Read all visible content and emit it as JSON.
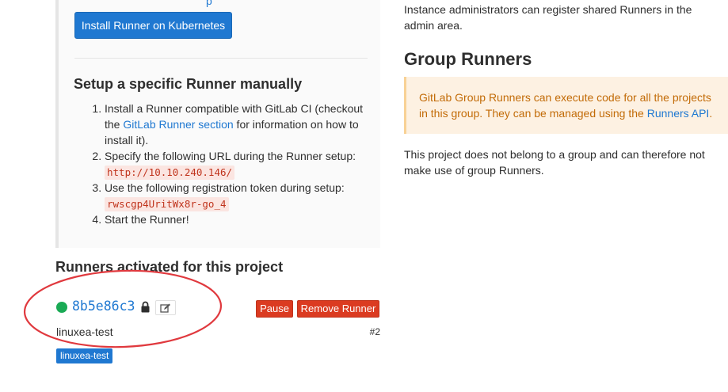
{
  "setup": {
    "top_partial_text": "p",
    "install_k8s_label": "Install Runner on Kubernetes",
    "title": "Setup a specific Runner manually",
    "step1_prefix": "Install a Runner compatible with GitLab CI (checkout the ",
    "step1_link": "GitLab Runner section",
    "step1_suffix": " for information on how to install it).",
    "step2_text": "Specify the following URL during the Runner setup:",
    "step2_url": "http://10.10.240.146/",
    "step3_text": "Use the following registration token during setup:",
    "step3_token": "rwscgp4UritWx8r-go_4",
    "step4_text": "Start the Runner!"
  },
  "activated": {
    "title": "Runners activated for this project",
    "runner": {
      "id": "8b5e86c3",
      "status_color": "#1aaa55",
      "description": "linuxea-test",
      "number": "#2",
      "tag": "linuxea-test",
      "pause_label": "Pause",
      "remove_label": "Remove Runner",
      "lock_icon": "lock-icon",
      "edit_icon": "pencil-square-icon"
    }
  },
  "shared": {
    "text": "Instance administrators can register shared Runners in the admin area."
  },
  "group": {
    "title": "Group Runners",
    "warning_prefix": "GitLab Group Runners can execute code for all the projects in this group. They can be managed using the ",
    "warning_link": "Runners API",
    "warning_suffix": ".",
    "note": "This project does not belong to a group and can therefore not make use of group Runners."
  },
  "colors": {
    "primary_blue": "#1f78d1",
    "danger_red": "#db3b21",
    "warning_bg": "#fdf1e2",
    "warning_text": "#c26b07",
    "annotation_red": "#e0393e"
  }
}
